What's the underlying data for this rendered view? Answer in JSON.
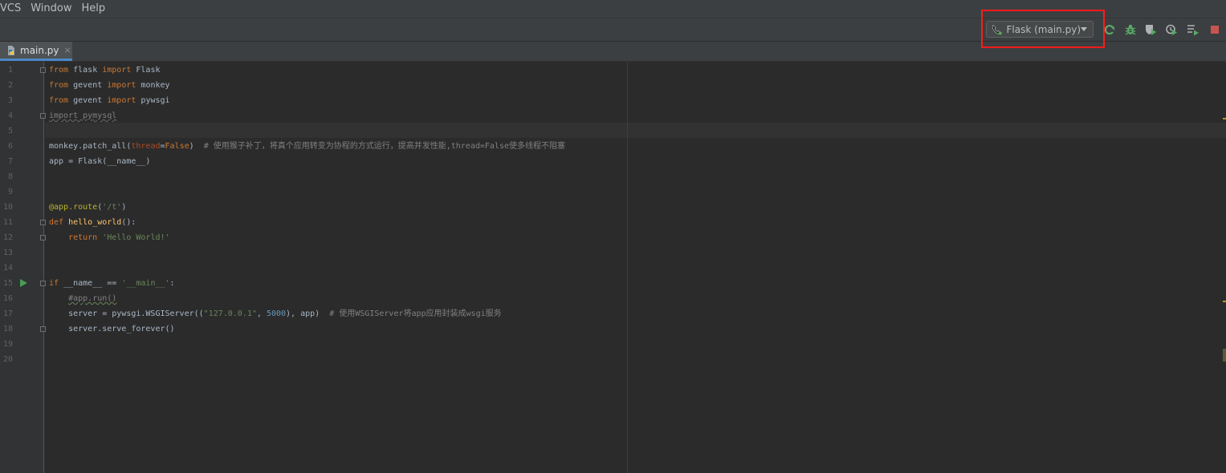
{
  "menu": {
    "items": [
      {
        "label": "VCS",
        "u": "S"
      },
      {
        "label": "Window",
        "u": "W"
      },
      {
        "label": "Help",
        "u": "H"
      }
    ]
  },
  "toolbar": {
    "run_config_label": "Flask (main.py)",
    "icons": [
      "rerun-icon",
      "debug-icon",
      "coverage-icon",
      "profile-icon",
      "concurrency-icon",
      "stop-icon"
    ],
    "highlight_color": "#ff1a1a"
  },
  "tab": {
    "label": "main.py",
    "close": "×"
  },
  "editor": {
    "line_numbers": [
      "1",
      "2",
      "3",
      "4",
      "5",
      "6",
      "7",
      "8",
      "9",
      "10",
      "11",
      "12",
      "13",
      "14",
      "15",
      "16",
      "17",
      "18",
      "19",
      "20"
    ],
    "lines": [
      [
        {
          "t": "from ",
          "c": "kw"
        },
        {
          "t": "flask ",
          "c": ""
        },
        {
          "t": "import ",
          "c": "kw"
        },
        {
          "t": "Flask",
          "c": ""
        }
      ],
      [
        {
          "t": "from ",
          "c": "kw"
        },
        {
          "t": "gevent ",
          "c": ""
        },
        {
          "t": "import ",
          "c": "kw"
        },
        {
          "t": "monkey",
          "c": ""
        }
      ],
      [
        {
          "t": "from ",
          "c": "kw"
        },
        {
          "t": "gevent ",
          "c": ""
        },
        {
          "t": "import ",
          "c": "kw"
        },
        {
          "t": "pywsgi",
          "c": ""
        }
      ],
      [
        {
          "t": "import pymysql",
          "c": "unused"
        }
      ],
      [],
      [
        {
          "t": "monkey.patch_all(",
          "c": ""
        },
        {
          "t": "thread",
          "c": "param"
        },
        {
          "t": "=",
          "c": ""
        },
        {
          "t": "False",
          "c": "kw"
        },
        {
          "t": ")  ",
          "c": ""
        },
        {
          "t": "# 使用猴子补丁，将真个应用转变为协程的方式运行，提高并发性能,thread=False使多线程不阻塞",
          "c": "cmt"
        }
      ],
      [
        {
          "t": "app = Flask(",
          "c": ""
        },
        {
          "t": "__name__",
          "c": ""
        },
        {
          "t": ")",
          "c": ""
        }
      ],
      [],
      [],
      [
        {
          "t": "@app.route",
          "c": "dec"
        },
        {
          "t": "(",
          "c": ""
        },
        {
          "t": "'/t'",
          "c": "str"
        },
        {
          "t": ")",
          "c": ""
        }
      ],
      [
        {
          "t": "def ",
          "c": "kw"
        },
        {
          "t": "hello_world",
          "c": "fn"
        },
        {
          "t": "():",
          "c": ""
        }
      ],
      [
        {
          "t": "    return ",
          "c": "kw"
        },
        {
          "t": "'Hello World!'",
          "c": "str"
        }
      ],
      [],
      [],
      [
        {
          "t": "if ",
          "c": "kw"
        },
        {
          "t": "__name__",
          "c": ""
        },
        {
          "t": " == ",
          "c": ""
        },
        {
          "t": "'__main__'",
          "c": "str"
        },
        {
          "t": ":",
          "c": ""
        }
      ],
      [
        {
          "t": "    ",
          "c": ""
        },
        {
          "t": "#app.run()",
          "c": "cmt typo"
        }
      ],
      [
        {
          "t": "    server = pywsgi.WSGIServer((",
          "c": ""
        },
        {
          "t": "\"127.0.0.1\"",
          "c": "str"
        },
        {
          "t": ", ",
          "c": ""
        },
        {
          "t": "5000",
          "c": "num"
        },
        {
          "t": "), app)  ",
          "c": ""
        },
        {
          "t": "# 使用WSGIServer将app应用封装成wsgi服务",
          "c": "cmt"
        }
      ],
      [
        {
          "t": "    server.serve_forever()",
          "c": ""
        }
      ],
      [],
      []
    ]
  }
}
